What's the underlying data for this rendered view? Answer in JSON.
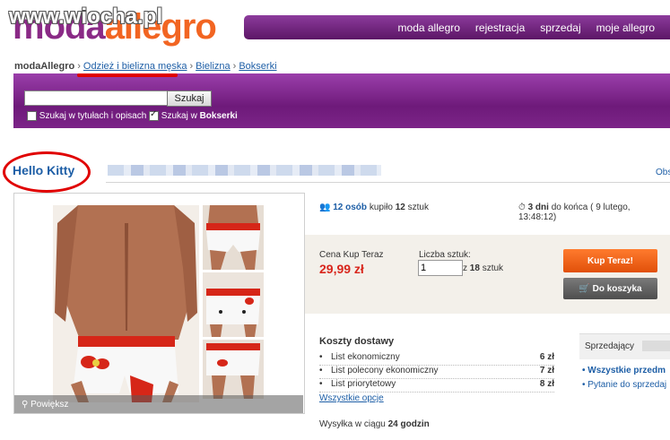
{
  "header": {
    "logo_part1": "moda",
    "logo_part2": "allegro",
    "watermark": "www.wiocha.pl",
    "nav": [
      "moda allegro",
      "rejestracja",
      "sprzedaj",
      "moje allegro"
    ]
  },
  "breadcrumb": {
    "root": "modaAllegro",
    "items": [
      "Odzież i bielizna męska",
      "Bielizna",
      "Bokserki"
    ],
    "separator": "›"
  },
  "search": {
    "input_value": "",
    "button_label": "Szukaj",
    "option1_label": "Szukaj w tytułach i opisach",
    "option1_checked": false,
    "option2_prefix": "Szukaj w",
    "option2_category": "Bokserki",
    "option2_checked": true
  },
  "listing": {
    "title": "Hello Kitty",
    "right_snippet": "Obs",
    "zoom_label": "Powiększ",
    "buyers_count": "12 osób",
    "buyers_text": "kupiło",
    "items_count": "12",
    "items_unit": "sztuk",
    "time_left": "3 dni",
    "time_suffix": "do końca",
    "end_date": "( 9 lutego, 13:48:12)"
  },
  "purchase": {
    "price_label": "Cena Kup Teraz",
    "price": "29,99 zł",
    "qty_label": "Liczba sztuk:",
    "qty_value": "1",
    "qty_max_prefix": "z",
    "qty_max": "18",
    "qty_max_unit": "sztuk",
    "buy_now_label": "Kup Teraz!",
    "cart_label": "Do koszyka"
  },
  "shipping": {
    "title": "Koszty dostawy",
    "options": [
      {
        "name": "List ekonomiczny",
        "price": "6 zł"
      },
      {
        "name": "List polecony ekonomiczny",
        "price": "7 zł"
      },
      {
        "name": "List priorytetowy",
        "price": "8 zł"
      }
    ],
    "all_options_link": "Wszystkie opcje",
    "dispatch_prefix": "Wysyłka w ciągu",
    "dispatch_time": "24 godzin"
  },
  "seller": {
    "label": "Sprzedający",
    "link1": "Wszystkie przedm",
    "link2": "Pytanie do sprzedaj"
  },
  "colors": {
    "purple": "#7c2488",
    "orange": "#f26522",
    "price_red": "#d8261c",
    "link_blue": "#1d5ea6",
    "annotation_red": "#e00000"
  }
}
